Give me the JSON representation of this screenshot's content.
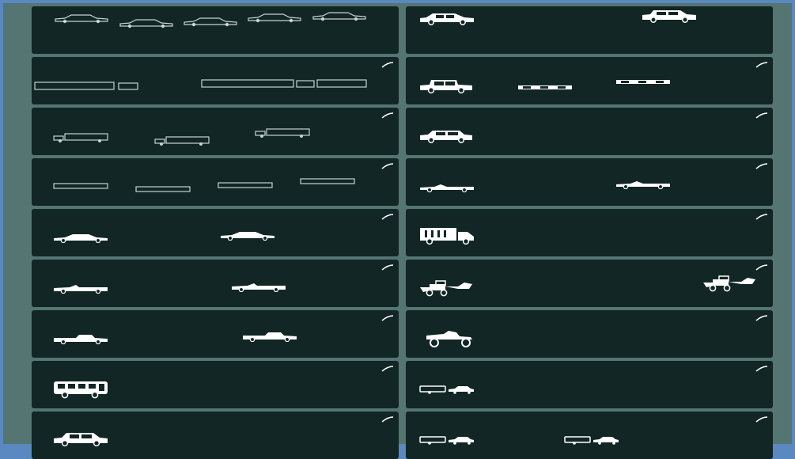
{
  "colors": {
    "background": "#547572",
    "panel": "#112625",
    "vehicle": "#ffffff",
    "outline": "#c8d4d2"
  },
  "left_column": [
    {
      "icons": [
        "sedan-outline-icon",
        "sedan-outline-icon",
        "sedan-outline-icon",
        "sedan-outline-icon",
        "sedan-outline-icon"
      ]
    },
    {
      "icons": [
        "semi-trailer-outline-icon",
        "semi-trailer-outline-icon"
      ]
    },
    {
      "icons": [
        "box-truck-outline-icon",
        "box-truck-outline-icon",
        "box-truck-outline-icon"
      ]
    },
    {
      "icons": [
        "trailer-outline-icon",
        "trailer-outline-icon",
        "trailer-outline-icon",
        "trailer-outline-icon"
      ]
    },
    {
      "icons": [
        "sports-sedan-icon",
        "sports-sedan-icon"
      ]
    },
    {
      "icons": [
        "convertible-icon",
        "convertible-icon"
      ]
    },
    {
      "icons": [
        "pickup-truck-icon",
        "pickup-truck-icon"
      ]
    },
    {
      "icons": [
        "bus-icon"
      ]
    },
    {
      "icons": [
        "suv-icon"
      ]
    }
  ],
  "right_column": [
    {
      "icons": [
        "hatchback-icon",
        "suv-icon"
      ]
    },
    {
      "icons": [
        "jeep-icon",
        "flatbed-trailer-icon",
        "flatbed-trailer-icon"
      ]
    },
    {
      "icons": [
        "station-wagon-icon"
      ]
    },
    {
      "icons": [
        "roadster-icon",
        "roadster-icon"
      ]
    },
    {
      "icons": [
        "delivery-truck-icon"
      ]
    },
    {
      "icons": [
        "backhoe-tractor-icon",
        "backhoe-tractor-icon"
      ]
    },
    {
      "icons": [
        "quad-bike-icon"
      ]
    },
    {
      "icons": [
        "car-with-camper-icon"
      ]
    },
    {
      "icons": [
        "car-with-camper-icon",
        "car-with-camper-icon"
      ]
    }
  ]
}
